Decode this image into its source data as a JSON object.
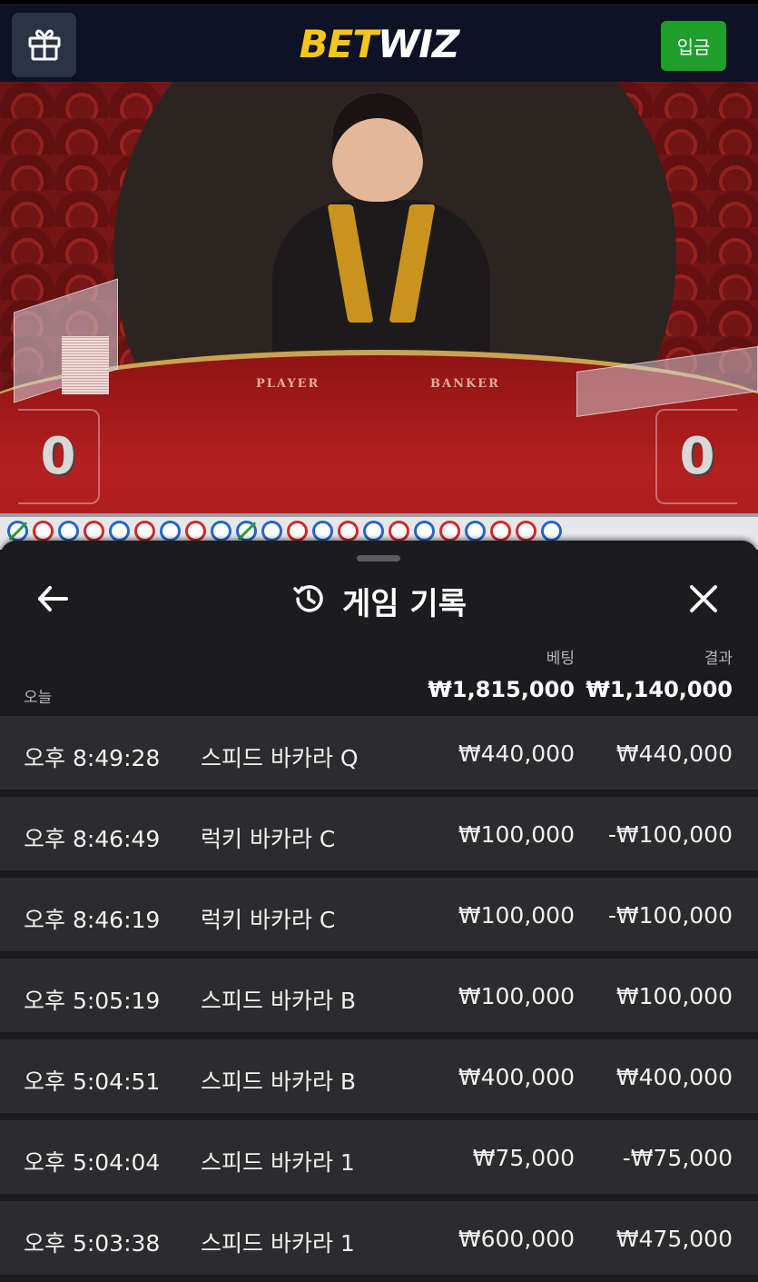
{
  "header": {
    "gift_icon": "gift-icon",
    "logo_part1": "BET",
    "logo_part2": "WIZ",
    "deposit_label": "입금",
    "colors": {
      "logo_yellow": "#f5c518",
      "deposit_green": "#1f9e2c",
      "bar_bg": "#0d1225"
    }
  },
  "video": {
    "player_label": "PLAYER",
    "banker_label": "BANKER",
    "player_score": "0",
    "banker_score": "0"
  },
  "sheet": {
    "title": "게임 기록",
    "history_icon": "history-icon",
    "back_icon": "arrow-left-icon",
    "close_icon": "close-icon",
    "col_bet": "베팅",
    "col_result": "결과",
    "today_label": "오늘",
    "total_bet": "₩1,815,000",
    "total_result": "₩1,140,000"
  },
  "rows": [
    {
      "time": "오후 8:49:28",
      "game": "스피드 바카라 Q",
      "bet": "₩440,000",
      "result": "₩440,000"
    },
    {
      "time": "오후 8:46:49",
      "game": "럭키 바카라 C",
      "bet": "₩100,000",
      "result": "-₩100,000"
    },
    {
      "time": "오후 8:46:19",
      "game": "럭키 바카라 C",
      "bet": "₩100,000",
      "result": "-₩100,000"
    },
    {
      "time": "오후 5:05:19",
      "game": "스피드 바카라 B",
      "bet": "₩100,000",
      "result": "₩100,000"
    },
    {
      "time": "오후 5:04:51",
      "game": "스피드 바카라 B",
      "bet": "₩400,000",
      "result": "₩400,000"
    },
    {
      "time": "오후 5:04:04",
      "game": "스피드 바카라 1",
      "bet": "₩75,000",
      "result": "-₩75,000"
    },
    {
      "time": "오후 5:03:38",
      "game": "스피드 바카라 1",
      "bet": "₩600,000",
      "result": "₩475,000"
    }
  ]
}
